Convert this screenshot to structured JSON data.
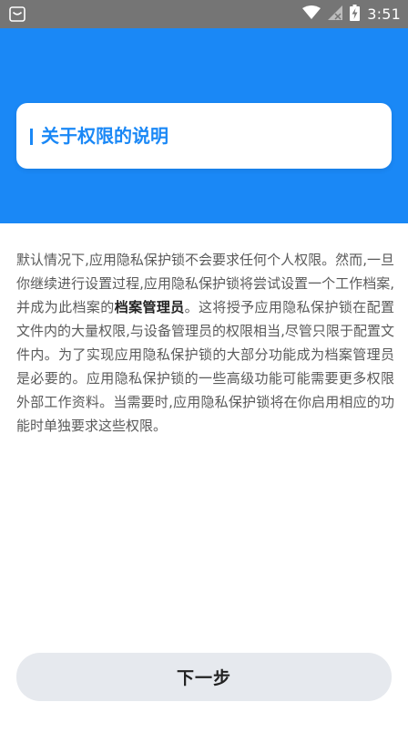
{
  "status_bar": {
    "time": "3:51",
    "icons": [
      "notification-icon",
      "wifi-icon",
      "signal-icon",
      "battery-charging-icon"
    ]
  },
  "header": {
    "title": "关于权限的说明"
  },
  "content": {
    "paragraph_before": "默认情况下,应用隐私保护锁不会要求任何个人权限。然而,一旦你继续进行设置过程,应用隐私保护锁将尝试设置一个工作档案,并成为此档案的",
    "paragraph_emphasis": "档案管理员",
    "paragraph_after": "。这将授予应用隐私保护锁在配置文件内的大量权限,与设备管理员的权限相当,尽管只限于配置文件内。为了实现应用隐私保护锁的大部分功能成为档案管理员是必要的。应用隐私保护锁的一些高级功能可能需要更多权限外部工作资料。当需要时,应用隐私保护锁将在你启用相应的功能时单独要求这些权限。"
  },
  "footer": {
    "next_label": "下一步"
  },
  "colors": {
    "primary": "#1a88f6",
    "status_bar": "#757575",
    "button_bg": "#e6e9ee"
  }
}
